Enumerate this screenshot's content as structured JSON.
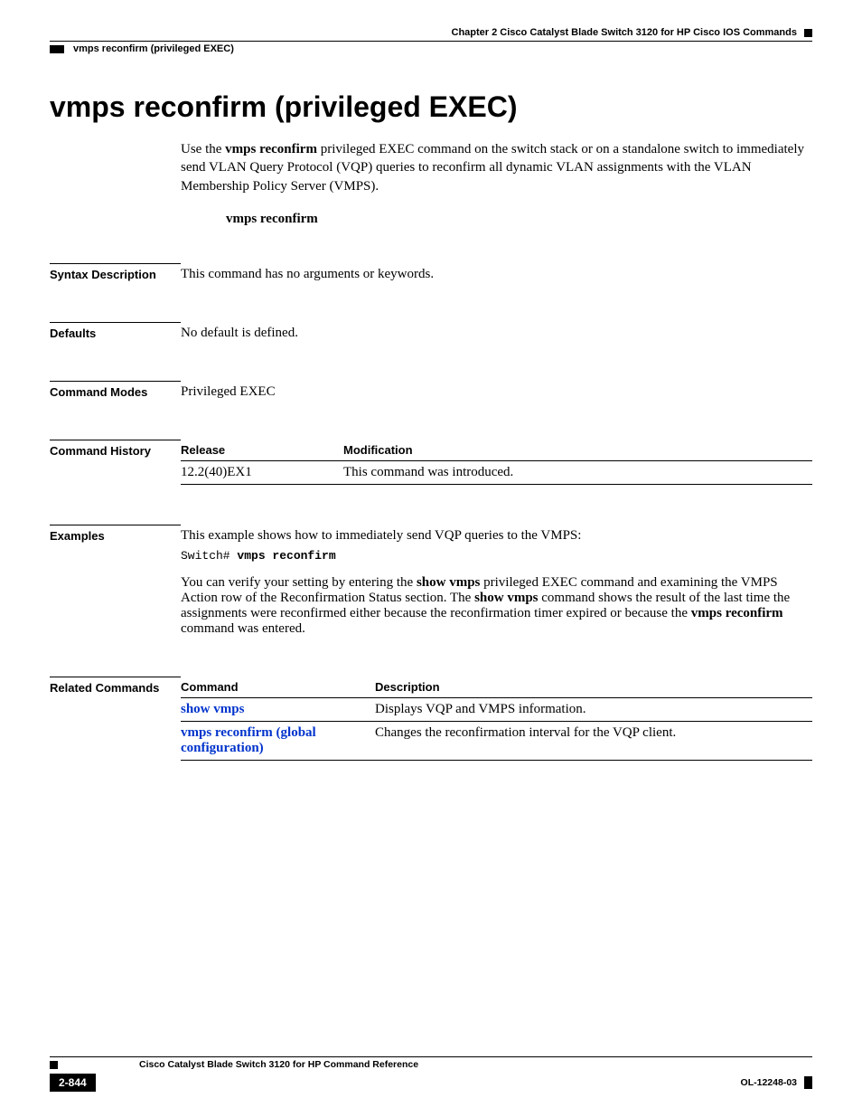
{
  "header": {
    "chapter": "Chapter 2  Cisco Catalyst Blade Switch 3120 for HP Cisco IOS Commands",
    "breadcrumb": "vmps reconfirm (privileged EXEC)"
  },
  "title": "vmps reconfirm (privileged EXEC)",
  "intro": {
    "pre": "Use the ",
    "cmd": "vmps reconfirm",
    "post": " privileged EXEC command on the switch stack or on a standalone switch to immediately send VLAN Query Protocol (VQP) queries to reconfirm all dynamic VLAN assignments with the VLAN Membership Policy Server (VMPS)."
  },
  "syntax_command": "vmps reconfirm",
  "sections": {
    "syntax_desc": {
      "label": "Syntax Description",
      "text": "This command has no arguments or keywords."
    },
    "defaults": {
      "label": "Defaults",
      "text": "No default is defined."
    },
    "modes": {
      "label": "Command Modes",
      "text": "Privileged EXEC"
    },
    "history": {
      "label": "Command History",
      "headers": {
        "c1": "Release",
        "c2": "Modification"
      },
      "rows": [
        {
          "c1": "12.2(40)EX1",
          "c2": "This command was introduced."
        }
      ]
    },
    "examples": {
      "label": "Examples",
      "intro": "This example shows how to immediately send VQP queries to the VMPS:",
      "code_prefix": "Switch# ",
      "code_cmd": "vmps reconfirm",
      "para_parts": {
        "p1": "You can verify your setting by entering the ",
        "b1": "show vmps",
        "p2": " privileged EXEC command and examining the VMPS Action row of the Reconfirmation Status section. The ",
        "b2": "show vmps",
        "p3": " command shows the result of the last time the assignments were reconfirmed either because the reconfirmation timer expired or because the ",
        "b3": "vmps reconfirm",
        "p4": " command was entered."
      }
    },
    "related": {
      "label": "Related Commands",
      "headers": {
        "c1": "Command",
        "c2": "Description"
      },
      "rows": [
        {
          "c1": "show vmps",
          "c2": "Displays VQP and VMPS information."
        },
        {
          "c1": "vmps reconfirm (global configuration)",
          "c2": "Changes the reconfirmation interval for the VQP client."
        }
      ]
    }
  },
  "footer": {
    "book": "Cisco Catalyst Blade Switch 3120 for HP Command Reference",
    "page": "2-844",
    "docid": "OL-12248-03"
  }
}
